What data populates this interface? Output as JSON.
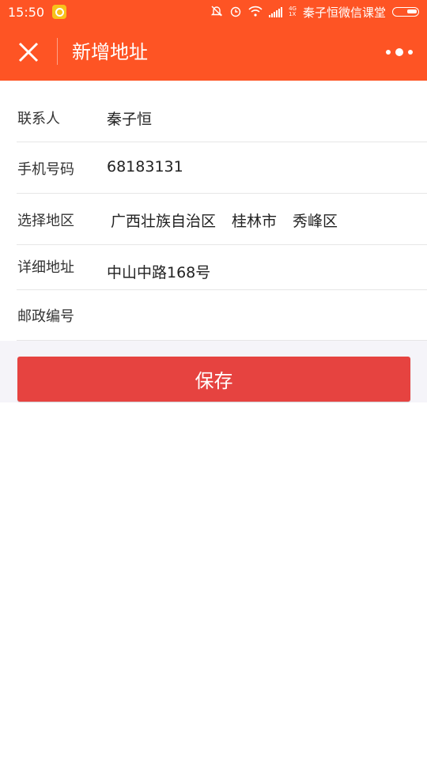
{
  "status_bar": {
    "time": "15:50",
    "net_top": "4G",
    "net_bottom": "1X",
    "carrier": "秦子恒微信课堂"
  },
  "nav": {
    "title": "新增地址",
    "close_icon": "close-icon",
    "more_icon": "more-dots-icon"
  },
  "form": {
    "contact": {
      "label": "联系人",
      "value": "秦子恒"
    },
    "phone": {
      "label": "手机号码",
      "value": "68183131"
    },
    "region": {
      "label": "选择地区",
      "province": "广西壮族自治区",
      "city": "桂林市",
      "district": "秀峰区"
    },
    "address": {
      "label": "详细地址",
      "value": "中山中路168号"
    },
    "postcode": {
      "label": "邮政编号",
      "value": ""
    }
  },
  "save_button": {
    "label": "保存",
    "color": "#e64340"
  },
  "colors": {
    "accent": "#fe5424",
    "page_bg": "#f5f4f9"
  }
}
